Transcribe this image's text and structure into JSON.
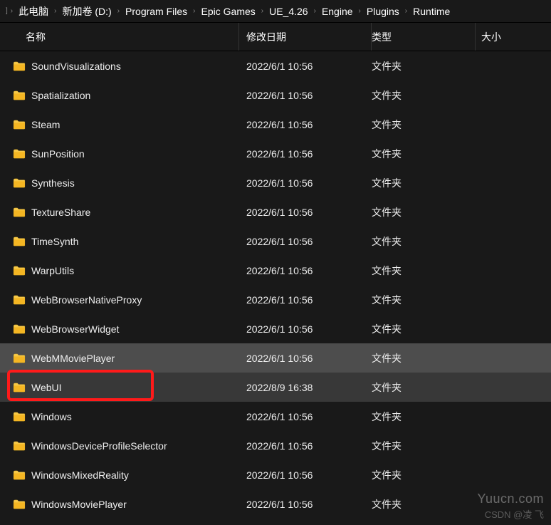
{
  "breadcrumb": [
    "此电脑",
    "新加卷 (D:)",
    "Program Files",
    "Epic Games",
    "UE_4.26",
    "Engine",
    "Plugins",
    "Runtime"
  ],
  "columns": {
    "name": "名称",
    "date": "修改日期",
    "type": "类型",
    "size": "大小"
  },
  "rows": [
    {
      "name": "SoundVisualizations",
      "date": "2022/6/1 10:56",
      "type": "文件夹",
      "state": ""
    },
    {
      "name": "Spatialization",
      "date": "2022/6/1 10:56",
      "type": "文件夹",
      "state": ""
    },
    {
      "name": "Steam",
      "date": "2022/6/1 10:56",
      "type": "文件夹",
      "state": ""
    },
    {
      "name": "SunPosition",
      "date": "2022/6/1 10:56",
      "type": "文件夹",
      "state": ""
    },
    {
      "name": "Synthesis",
      "date": "2022/6/1 10:56",
      "type": "文件夹",
      "state": ""
    },
    {
      "name": "TextureShare",
      "date": "2022/6/1 10:56",
      "type": "文件夹",
      "state": ""
    },
    {
      "name": "TimeSynth",
      "date": "2022/6/1 10:56",
      "type": "文件夹",
      "state": ""
    },
    {
      "name": "WarpUtils",
      "date": "2022/6/1 10:56",
      "type": "文件夹",
      "state": ""
    },
    {
      "name": "WebBrowserNativeProxy",
      "date": "2022/6/1 10:56",
      "type": "文件夹",
      "state": ""
    },
    {
      "name": "WebBrowserWidget",
      "date": "2022/6/1 10:56",
      "type": "文件夹",
      "state": ""
    },
    {
      "name": "WebMMoviePlayer",
      "date": "2022/6/1 10:56",
      "type": "文件夹",
      "state": "hover"
    },
    {
      "name": "WebUI",
      "date": "2022/8/9 16:38",
      "type": "文件夹",
      "state": "selected highlighted"
    },
    {
      "name": "Windows",
      "date": "2022/6/1 10:56",
      "type": "文件夹",
      "state": ""
    },
    {
      "name": "WindowsDeviceProfileSelector",
      "date": "2022/6/1 10:56",
      "type": "文件夹",
      "state": ""
    },
    {
      "name": "WindowsMixedReality",
      "date": "2022/6/1 10:56",
      "type": "文件夹",
      "state": ""
    },
    {
      "name": "WindowsMoviePlayer",
      "date": "2022/6/1 10:56",
      "type": "文件夹",
      "state": ""
    }
  ],
  "watermark": "Yuucn.com",
  "watermark2": "CSDN @凌 飞"
}
